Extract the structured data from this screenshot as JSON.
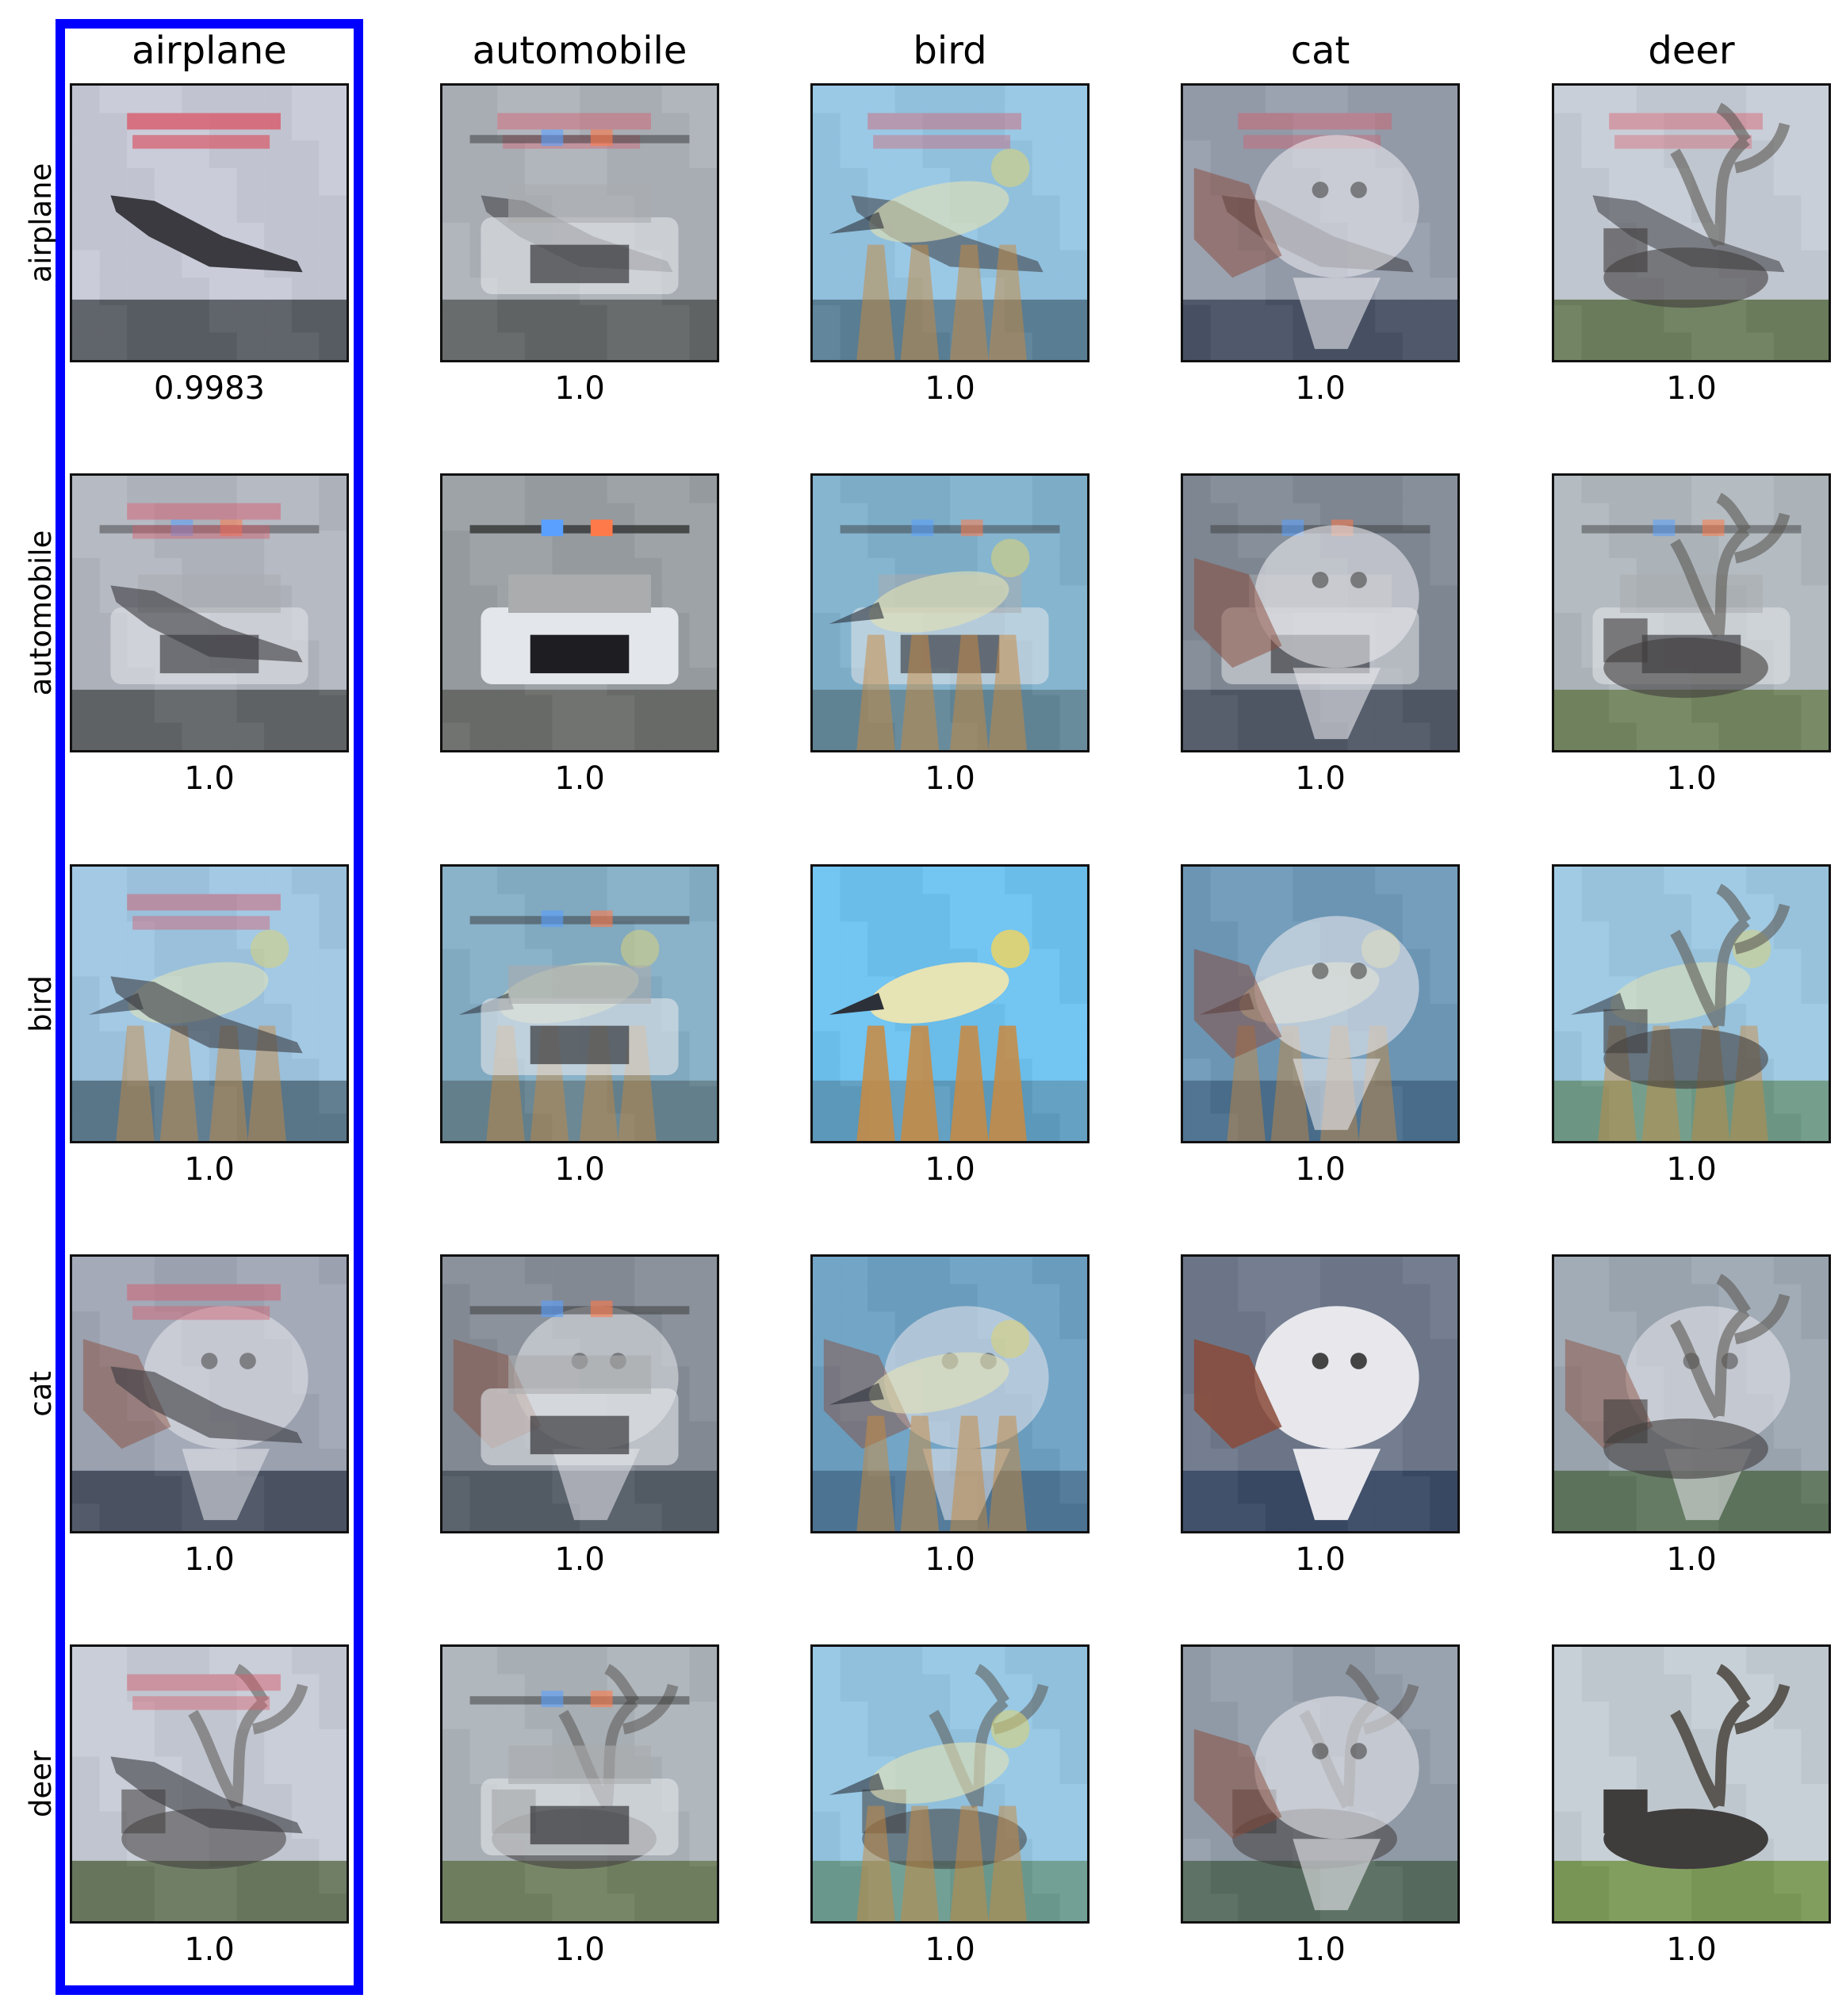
{
  "columns": [
    "airplane",
    "automobile",
    "bird",
    "cat",
    "deer"
  ],
  "rows": [
    "airplane",
    "automobile",
    "bird",
    "cat",
    "deer"
  ],
  "scores": [
    [
      "0.9983",
      "1.0",
      "1.0",
      "1.0",
      "1.0"
    ],
    [
      "1.0",
      "1.0",
      "1.0",
      "1.0",
      "1.0"
    ],
    [
      "1.0",
      "1.0",
      "1.0",
      "1.0",
      "1.0"
    ],
    [
      "1.0",
      "1.0",
      "1.0",
      "1.0",
      "1.0"
    ],
    [
      "1.0",
      "1.0",
      "1.0",
      "1.0",
      "1.0"
    ]
  ],
  "highlighted_column": 0,
  "highlight_color": "#0000ff",
  "image_subjects": {
    "airplane": "airplane on poster",
    "automobile": "police car front",
    "bird": "yellow bird on stand",
    "cat": "white cat",
    "deer": "reindeer with antlers"
  },
  "palette": {
    "airplane": {
      "bg": "#c9ccd8",
      "ground": "#5b5f66",
      "subject": "#3a3a40",
      "accent": "#d85a6a"
    },
    "automobile": {
      "bg": "#9aa0a4",
      "ground": "#6b6e6a",
      "subject": "#e3e6ea",
      "accent": "#3d2f2a"
    },
    "bird": {
      "bg": "#6ec3f2",
      "ground": "#5f9ec0",
      "subject": "#e6e3b4",
      "accent": "#c98a3f"
    },
    "cat": {
      "bg": "#6f7a8c",
      "ground": "#3b4a66",
      "subject": "#e7e7ec",
      "accent": "#8a4a3a"
    },
    "deer": {
      "bg": "#c6cfd6",
      "ground": "#7e9b5a",
      "subject": "#3f3c3c",
      "accent": "#5b5853"
    }
  }
}
